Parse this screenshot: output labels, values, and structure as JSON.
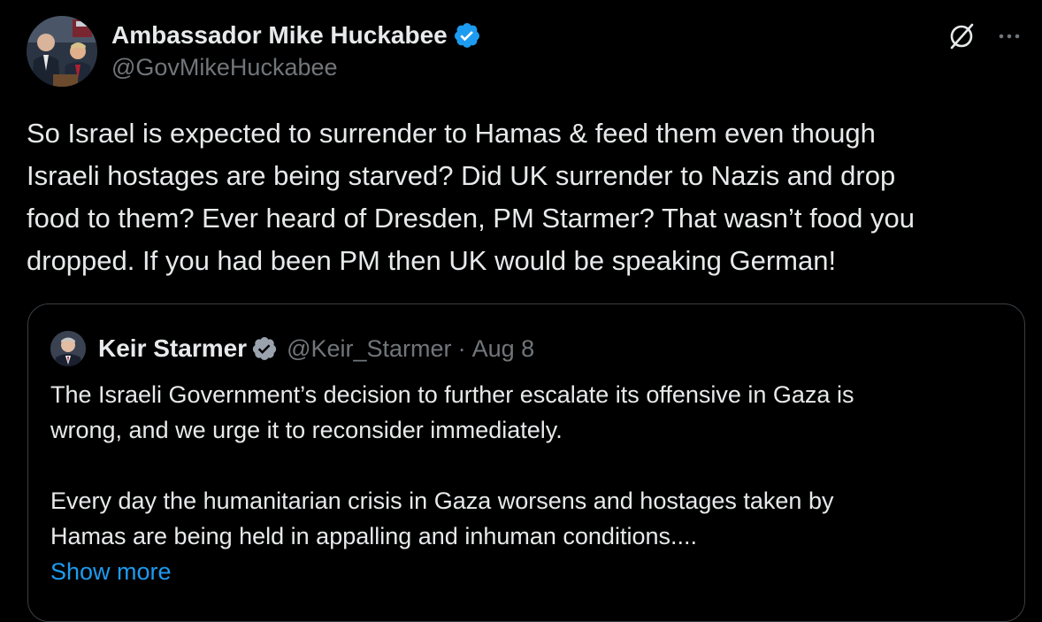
{
  "colors": {
    "background": "#000000",
    "text_primary": "#e7e9ea",
    "text_secondary": "#71767b",
    "accent_link": "#1d9bf0",
    "verified_badge": "#1d9bf0",
    "quote_border": "#3a3f44"
  },
  "tweet": {
    "author": {
      "name": "Ambassador Mike Huckabee",
      "handle": "@GovMikeHuckabee",
      "avatar_icon": "profile-photo",
      "verified_icon": "verified-badge-icon"
    },
    "actions": {
      "grok_icon": "grok-icon",
      "more_icon": "more-horizontal-icon"
    },
    "text_lines": [
      "So Israel is expected to surrender to Hamas & feed them even though",
      "Israeli hostages are being starved?  Did UK surrender to Nazis and drop",
      "food to them? Ever heard of Dresden, PM Starmer?  That wasn’t food you",
      "dropped. If you had been PM then UK would be speaking German!"
    ]
  },
  "quoted_tweet": {
    "author": {
      "name": "Keir Starmer",
      "handle": "@Keir_Starmer",
      "separator": "·",
      "date": "Aug 8",
      "avatar_icon": "profile-photo",
      "verified_icon": "verified-badge-icon"
    },
    "paragraph_1_lines": [
      "The Israeli Government’s decision to further escalate its offensive in Gaza is",
      "wrong, and we urge it to reconsider immediately."
    ],
    "paragraph_2_lines": [
      "Every day the humanitarian crisis in Gaza worsens and hostages taken by",
      "Hamas are being held in appalling and inhuman conditions...."
    ],
    "show_more_label": "Show more"
  }
}
